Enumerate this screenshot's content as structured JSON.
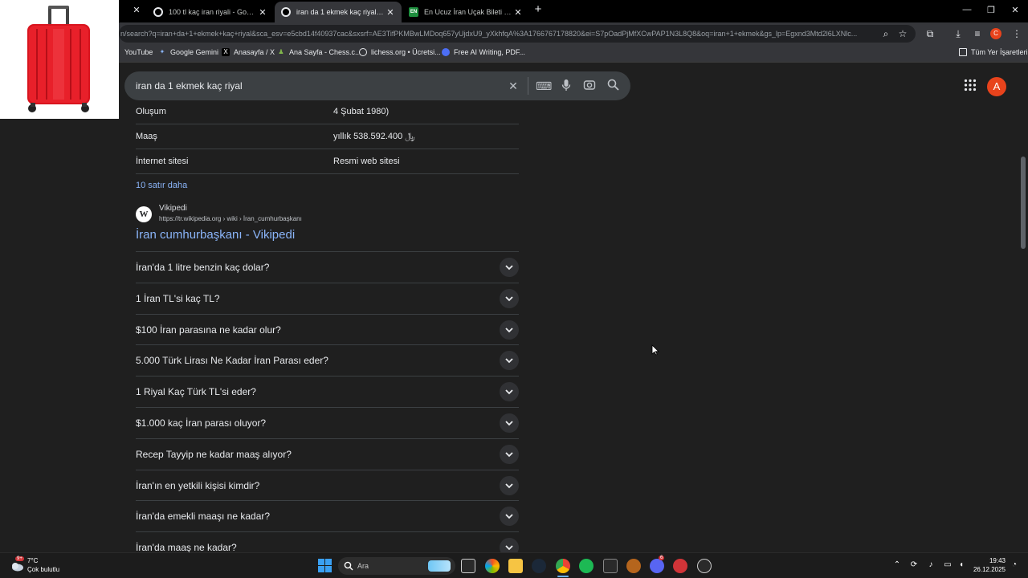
{
  "tabs": [
    {
      "title": "100 tl kaç iran riyali - Google'da",
      "favicon": "google-icon",
      "active": false
    },
    {
      "title": "iran da 1 ekmek kaç riyal - Goo",
      "favicon": "google-icon",
      "active": true
    },
    {
      "title": "En Ucuz İran Uçak Bileti Fiyatlar",
      "favicon": "enuygun-icon",
      "favicon_text": "EN",
      "active": false
    }
  ],
  "address_bar": {
    "url": "n/search?q=iran+da+1+ekmek+kaç+riyal&sca_esv=e5cbd14f40937cac&sxsrf=AE3TifPKMBwLMDoq657yUjdxU9_yXkhfqA%3A1766767178820&ei=S7pOadPjMfXCwPAP1N3L8Q8&oq=iran+1+ekmek&gs_lp=Egxnd3Mtd2l6LXNlc..."
  },
  "profile_initial": "C",
  "bookmarks": [
    {
      "label": "YouTube",
      "icon": "youtube-icon"
    },
    {
      "label": "Google Gemini",
      "icon": "gemini-icon"
    },
    {
      "label": "Anasayfa / X",
      "icon": "x-icon"
    },
    {
      "label": "Ana Sayfa - Chess.c...",
      "icon": "chess-icon"
    },
    {
      "label": "lichess.org • Ücretsi...",
      "icon": "lichess-icon"
    },
    {
      "label": "Free AI Writing, PDF...",
      "icon": "ai-writing-icon"
    }
  ],
  "all_bookmarks": "Tüm Yer İşaretleri",
  "search": {
    "query": "iran da 1 ekmek kaç riyal",
    "account_initial": "A"
  },
  "info_rows": [
    {
      "key": "Oluşum",
      "value": "4 Şubat 1980)"
    },
    {
      "key": "Maaş",
      "value": "yıllık ﷼ 538.592.400"
    },
    {
      "key": "İnternet sitesi",
      "value": "Resmi web sitesi"
    }
  ],
  "more_rows_link": "10 satır daha",
  "source": {
    "site": "Vikipedi",
    "logo_letter": "W",
    "url": "https://tr.wikipedia.org › wiki › İran_cumhurbaşkanı",
    "title": "İran cumhurbaşkanı - Vikipedi"
  },
  "faq": [
    "İran'da 1 litre benzin kaç dolar?",
    "1 İran TL'si kaç TL?",
    "$100 İran parasına ne kadar olur?",
    "5.000 Türk Lirası Ne Kadar İran Parası eder?",
    "1 Riyal Kaç Türk TL'si eder?",
    "$1.000 kaç İran parası oluyor?",
    "Recep Tayyip ne kadar maaş alıyor?",
    "İran'ın en yetkili kişisi kimdir?",
    "İran'da emekli maaşı ne kadar?",
    "İran'da maaş ne kadar?"
  ],
  "taskbar": {
    "weather_temp": "7°C",
    "weather_desc": "Çok bulutlu",
    "weather_badge": "9+",
    "search_label": "Ara",
    "time": "19:43",
    "date": "26.12.2025",
    "discord_badge": "6"
  },
  "colors": {
    "link": "#8ab4f8",
    "avatar": "#e8431c",
    "background": "#1f1f1f"
  }
}
